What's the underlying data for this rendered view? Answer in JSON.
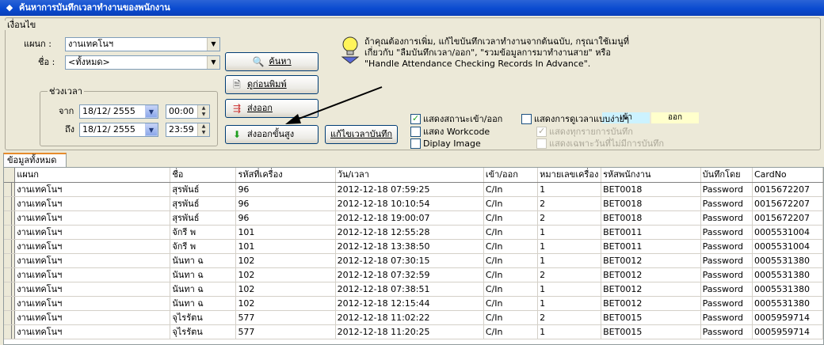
{
  "window": {
    "title": "ค้นหาการบันทึกเวลาทำงานของพนักงาน"
  },
  "conditions": {
    "legend": "เงื่อนไข",
    "department_label": "แผนก :",
    "department_value": "งานเทคโนฯ",
    "name_label": "ชื่อ :",
    "name_value": "<ทั้งหมด>",
    "period_legend": "ช่วงเวลา",
    "from_label": "จาก",
    "to_label": "ถึง",
    "from_date": "18/12/ 2555",
    "from_time": "00:00",
    "to_date": "18/12/ 2555",
    "to_time": "23:59"
  },
  "buttons": {
    "search": "ค้นหา",
    "preview": "ดูก่อนพิมพ์",
    "export": "ส่งออก",
    "export_advanced": "ส่งออกขั้นสูง",
    "edit_records": "แก้ไขเวลาบันทึก"
  },
  "info": {
    "line1": "ถ้าคุณต้องการเพิ่ม, แก้ไขบันทึกเวลาทำงานจากต้นฉบับ, กรุณาใช้เมนูที่",
    "line2": "เกี่ยวกับ \"ลืมบันทึกเวลา/ออก\", \"รวมข้อมูลการมาทำงานสาย\" หรือ",
    "line3": "\"Handle Attendance Checking Records In Advance\"."
  },
  "legend_swatches": {
    "in": "เข้า",
    "out": "ออก",
    "in_color": "#ccf2ff",
    "out_color": "#ffffcc"
  },
  "options": {
    "show_in_out": {
      "label": "แสดงสถานะเข้า/ออก",
      "checked": true
    },
    "show_workcode": {
      "label": "แสดง Workcode",
      "checked": false
    },
    "display_image": {
      "label": "Diplay Image",
      "checked": false
    },
    "simple_view": {
      "label": "แสดงการดูเวลาแบบง่ายๆ",
      "checked": false
    },
    "show_all_records": {
      "label": "แสดงทุกรายการบันทึก",
      "checked": true
    },
    "show_no_record_days": {
      "label": "แสดงเฉพาะวันที่ไม่มีการบันทึก",
      "checked": false
    }
  },
  "tabs": {
    "all_data": "ข้อมูลทั้งหมด"
  },
  "grid": {
    "columns": [
      "แผนก",
      "ชื่อ",
      "รหัสที่เครื่อง",
      "วัน/เวลา",
      "เข้า/ออก",
      "หมายเลขเครื่อง",
      "รหัสพนักงาน",
      "บันทึกโดย",
      "CardNo"
    ],
    "rows": [
      [
        "งานเทคโนฯ",
        "สุรพันธ์",
        "96",
        "2012-12-18 07:59:25",
        "C/In",
        "1",
        "BET0018",
        "Password",
        "0015672207"
      ],
      [
        "งานเทคโนฯ",
        "สุรพันธ์",
        "96",
        "2012-12-18 10:10:54",
        "C/In",
        "2",
        "BET0018",
        "Password",
        "0015672207"
      ],
      [
        "งานเทคโนฯ",
        "สุรพันธ์",
        "96",
        "2012-12-18 19:00:07",
        "C/In",
        "2",
        "BET0018",
        "Password",
        "0015672207"
      ],
      [
        "งานเทคโนฯ",
        "จักรี พ",
        "101",
        "2012-12-18 12:55:28",
        "C/In",
        "1",
        "BET0011",
        "Password",
        "0005531004"
      ],
      [
        "งานเทคโนฯ",
        "จักรี พ",
        "101",
        "2012-12-18 13:38:50",
        "C/In",
        "1",
        "BET0011",
        "Password",
        "0005531004"
      ],
      [
        "งานเทคโนฯ",
        "นันทา ฉ",
        "102",
        "2012-12-18 07:30:15",
        "C/In",
        "1",
        "BET0012",
        "Password",
        "0005531380"
      ],
      [
        "งานเทคโนฯ",
        "นันทา ฉ",
        "102",
        "2012-12-18 07:32:59",
        "C/In",
        "2",
        "BET0012",
        "Password",
        "0005531380"
      ],
      [
        "งานเทคโนฯ",
        "นันทา ฉ",
        "102",
        "2012-12-18 07:38:51",
        "C/In",
        "1",
        "BET0012",
        "Password",
        "0005531380"
      ],
      [
        "งานเทคโนฯ",
        "นันทา ฉ",
        "102",
        "2012-12-18 12:15:44",
        "C/In",
        "1",
        "BET0012",
        "Password",
        "0005531380"
      ],
      [
        "งานเทคโนฯ",
        "จุไรรัตน",
        "577",
        "2012-12-18 11:02:22",
        "C/In",
        "2",
        "BET0015",
        "Password",
        "0005959714"
      ],
      [
        "งานเทคโนฯ",
        "จุไรรัตน",
        "577",
        "2012-12-18 11:20:25",
        "C/In",
        "1",
        "BET0015",
        "Password",
        "0005959714"
      ]
    ]
  }
}
